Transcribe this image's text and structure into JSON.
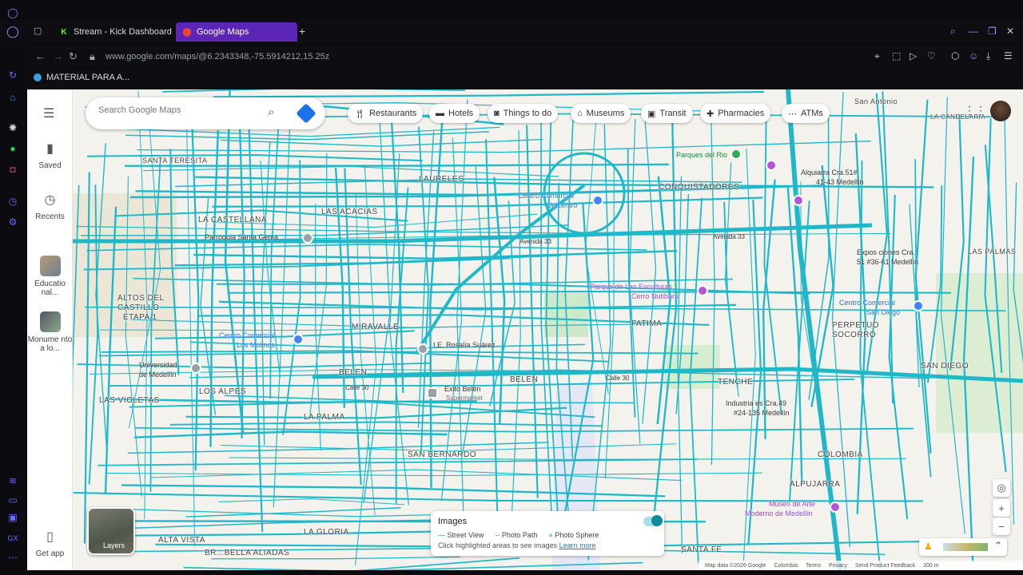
{
  "browser": {
    "tabs": [
      {
        "label": "Stream - Kick Dashboard",
        "favicon": "K"
      },
      {
        "label": "Google Maps",
        "favicon": "maps-pin"
      }
    ],
    "url": "www.google.com/maps/@6.2343348,-75.5914212,15.25z",
    "bookmark": "MATERIAL PARA A...",
    "accent": "#5b25b8"
  },
  "maps": {
    "search_placeholder": "Search Google Maps",
    "left_panel": {
      "saved": "Saved",
      "recents": "Recents",
      "item1": "Educatio nal...",
      "item2": "Monume nto a lo...",
      "get_app": "Get app"
    },
    "chips": [
      "Restaurants",
      "Hotels",
      "Things to do",
      "Museums",
      "Transit",
      "Pharmacies",
      "ATMs"
    ],
    "layers_label": "Layers",
    "images_panel": {
      "title": "Images",
      "street_view": "Street View",
      "photo_path": "Photo Path",
      "photo_sphere": "Photo Sphere",
      "hint": "Click highlighted areas to see images",
      "learn_more": "Learn more"
    },
    "footer": [
      "Map data ©2026 Google",
      "Colombia",
      "Terms",
      "Privacy",
      "Send Product Feedback",
      "200 m"
    ],
    "neighborhoods": {
      "laureles": "LAURELES",
      "santa_teresita": "SANTA TERESITA",
      "la_castellana": "LA CASTELLANA",
      "las_acacias": "LAS ACACIAS",
      "conquistadores": "CONQUISTADORES",
      "altos": "ALTOS DEL",
      "castillo": "CASTILLO",
      "etapa": "ETAPA 1",
      "miravalle": "MIRAVALLE",
      "fatima": "FATIMA",
      "perpetuo": "PERPETUO",
      "socorro": "SOCORRO",
      "san_diego": "SAN DIEGO",
      "las_violetas": "LAS VIOLETAS",
      "los_alpes": "LOS ALPES",
      "belen1": "BELEN",
      "belen2": "BELEN",
      "tenche": "TENCHE",
      "la_palma": "LA PALMA",
      "san_bernardo": "SAN BERNARDO",
      "colombia": "COLOMBIA",
      "alpujarra": "ALPUJARRA",
      "la_gloria": "LA GLORIA",
      "alta_vista": "ALTA VISTA",
      "bellaaliadas": "BR...BELLA ALIADAS",
      "santa_fe": "SANTA FE",
      "san_antonio": "San Antonio",
      "las_palmas": "LAS PALMAS",
      "la_candelaria": "LA CANDELARIA"
    },
    "pois": {
      "parques_rio": "Parques del Rio",
      "alquiarra": "Alquiarra Cra.51#",
      "alquiarra2": "41-43 Medellín",
      "cc_unicentro": "Centro Comercial",
      "cc_unicentro2": "Unicentro",
      "parroquia": "Parroquia Santa Gema",
      "parque_esculturas": "Parque de Las Esculturas",
      "cerro": "Cerro Nutibara",
      "expos": "Expos ciones Cra.",
      "expos2": "51 #36-61 Medellín",
      "cc_sandiego": "Centro Comercial",
      "cc_sandiego2": "San Diego",
      "cc_molinos": "Centro Comercial",
      "cc_molinos2": "Los Molinos",
      "ie_rosalia": "I.E. Rosalía Suárez",
      "univ": "Universidad",
      "univ2": "de Medellín",
      "exito": "Exito Belén",
      "exito2": "Supermarket",
      "industria": "Industria es Cra.49",
      "industria2": "#24-135 Medellín",
      "museo": "Museo de Arte",
      "museo2": "Moderno de Medellín",
      "avenida33": "Avenida 33",
      "avenida33b": "Avenida 33",
      "calle30": "Calle 30",
      "calle30b": "Calle 30"
    }
  }
}
